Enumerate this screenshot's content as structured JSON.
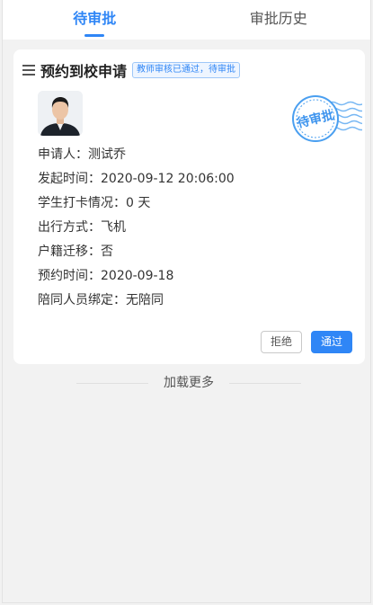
{
  "tabs": [
    {
      "label": "待审批",
      "active": true
    },
    {
      "label": "审批历史",
      "active": false
    }
  ],
  "card": {
    "title": "预约到校申请",
    "badge": "教师审核已通过，待审批",
    "stamp_text": "待审批",
    "fields": {
      "applicant": "申请人：测试乔",
      "start_time": "发起时间：2020-09-12 20:06:00",
      "checkin": "学生打卡情况：0 天",
      "travel": "出行方式：飞机",
      "household": "户籍迁移：否",
      "appointment": "预约时间：2020-09-18",
      "companion": "陪同人员绑定：无陪同"
    },
    "reject_label": "拒绝",
    "pass_label": "通过"
  },
  "load_more": "加载更多",
  "colors": {
    "accent": "#2f86f6",
    "background": "#f2f2f2"
  }
}
